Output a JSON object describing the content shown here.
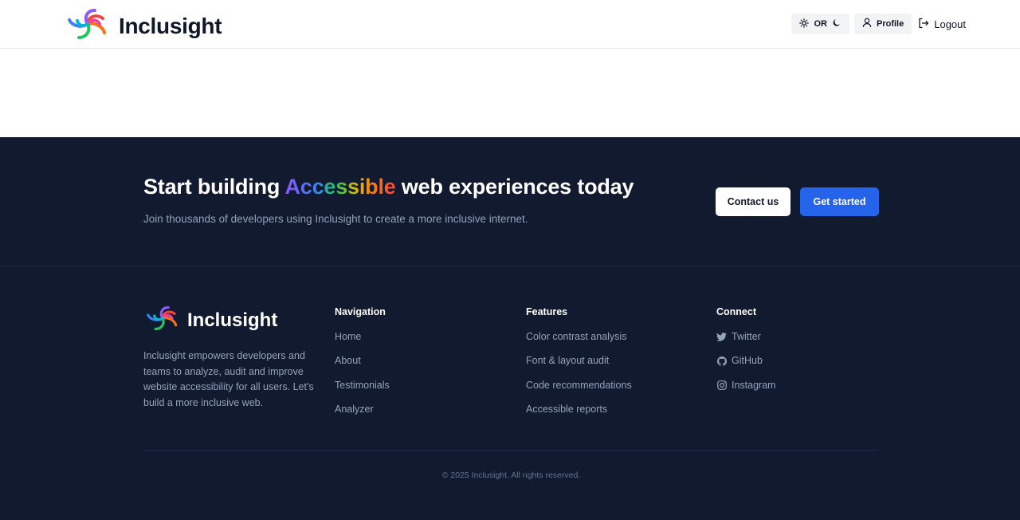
{
  "header": {
    "brand": "Inclusight",
    "theme_toggle_text": "OR",
    "profile_label": "Profile",
    "logout_label": "Logout"
  },
  "cta": {
    "title_before": "Start building ",
    "title_highlight": "Accessible",
    "title_after": " web experiences today",
    "subtitle": "Join thousands of developers using Inclusight to create a more inclusive internet.",
    "contact_label": "Contact us",
    "get_started_label": "Get started"
  },
  "footer": {
    "brand": "Inclusight",
    "description": "Inclusight empowers developers and teams to analyze, audit and improve website accessibility for all users. Let's build a more inclusive web.",
    "navigation": {
      "heading": "Navigation",
      "items": [
        "Home",
        "About",
        "Testimonials",
        "Analyzer"
      ]
    },
    "features": {
      "heading": "Features",
      "items": [
        "Color contrast analysis",
        "Font & layout audit",
        "Code recommendations",
        "Accessible reports"
      ]
    },
    "connect": {
      "heading": "Connect",
      "items": [
        {
          "label": "Twitter",
          "icon": "twitter-icon"
        },
        {
          "label": "GitHub",
          "icon": "github-icon"
        },
        {
          "label": "Instagram",
          "icon": "instagram-icon"
        }
      ]
    },
    "copyright": "© 2025 Inclusight. All rights reserved."
  },
  "colors": {
    "dark_bg": "#111a2e",
    "primary_button": "#2563eb",
    "muted_text": "#94a3b8"
  }
}
